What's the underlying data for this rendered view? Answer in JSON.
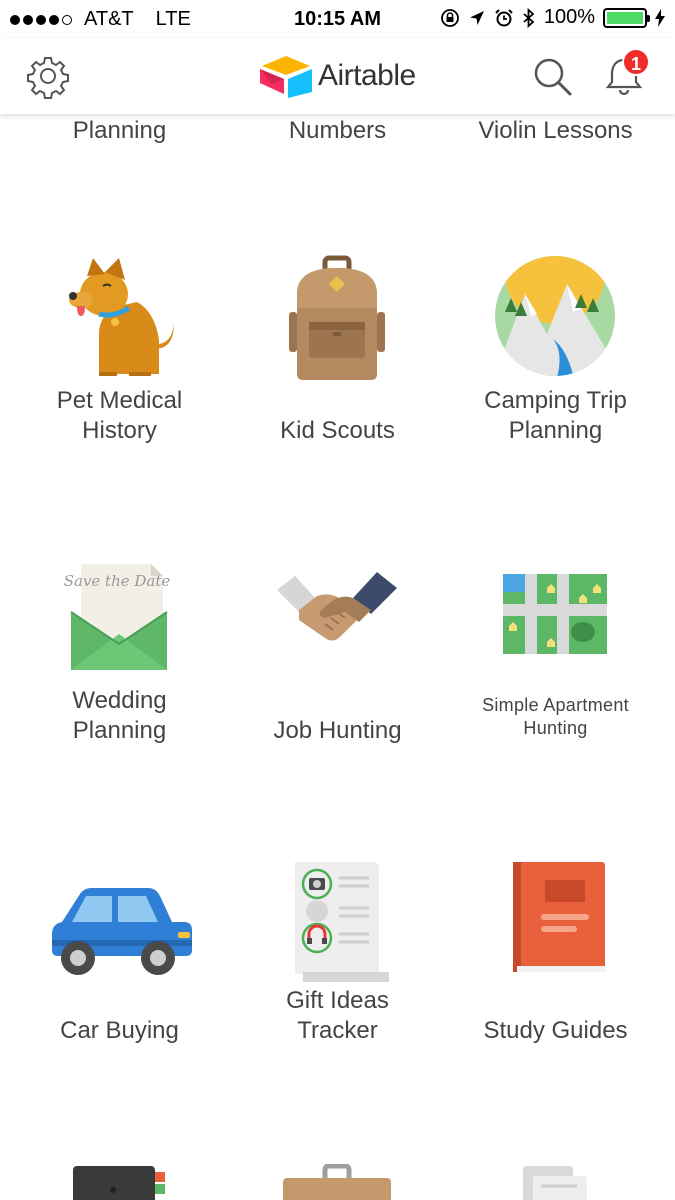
{
  "status_bar": {
    "carrier": "AT&T",
    "network": "LTE",
    "time": "10:15 AM",
    "battery": "100%",
    "signal_bars_filled": 4,
    "signal_bars_total": 5
  },
  "header": {
    "app_name": "Airtable",
    "notification_count": "1"
  },
  "templates": {
    "row0": [
      "Planning",
      "Numbers",
      "Violin Lessons"
    ],
    "pet_medical": "Pet Medical\nHistory",
    "kid_scouts": "Kid Scouts",
    "camping": "Camping Trip\nPlanning",
    "wedding": "Wedding\nPlanning",
    "job_hunting": "Job Hunting",
    "apartment": "Simple Apartment\nHunting",
    "car_buying": "Car Buying",
    "gift_ideas": "Gift Ideas\nTracker",
    "study_guides": "Study Guides"
  },
  "icon_text": {
    "save_the_date": "Save the Date"
  },
  "colors": {
    "notification_badge": "#f02b2b",
    "battery_fill": "#4cd964"
  }
}
